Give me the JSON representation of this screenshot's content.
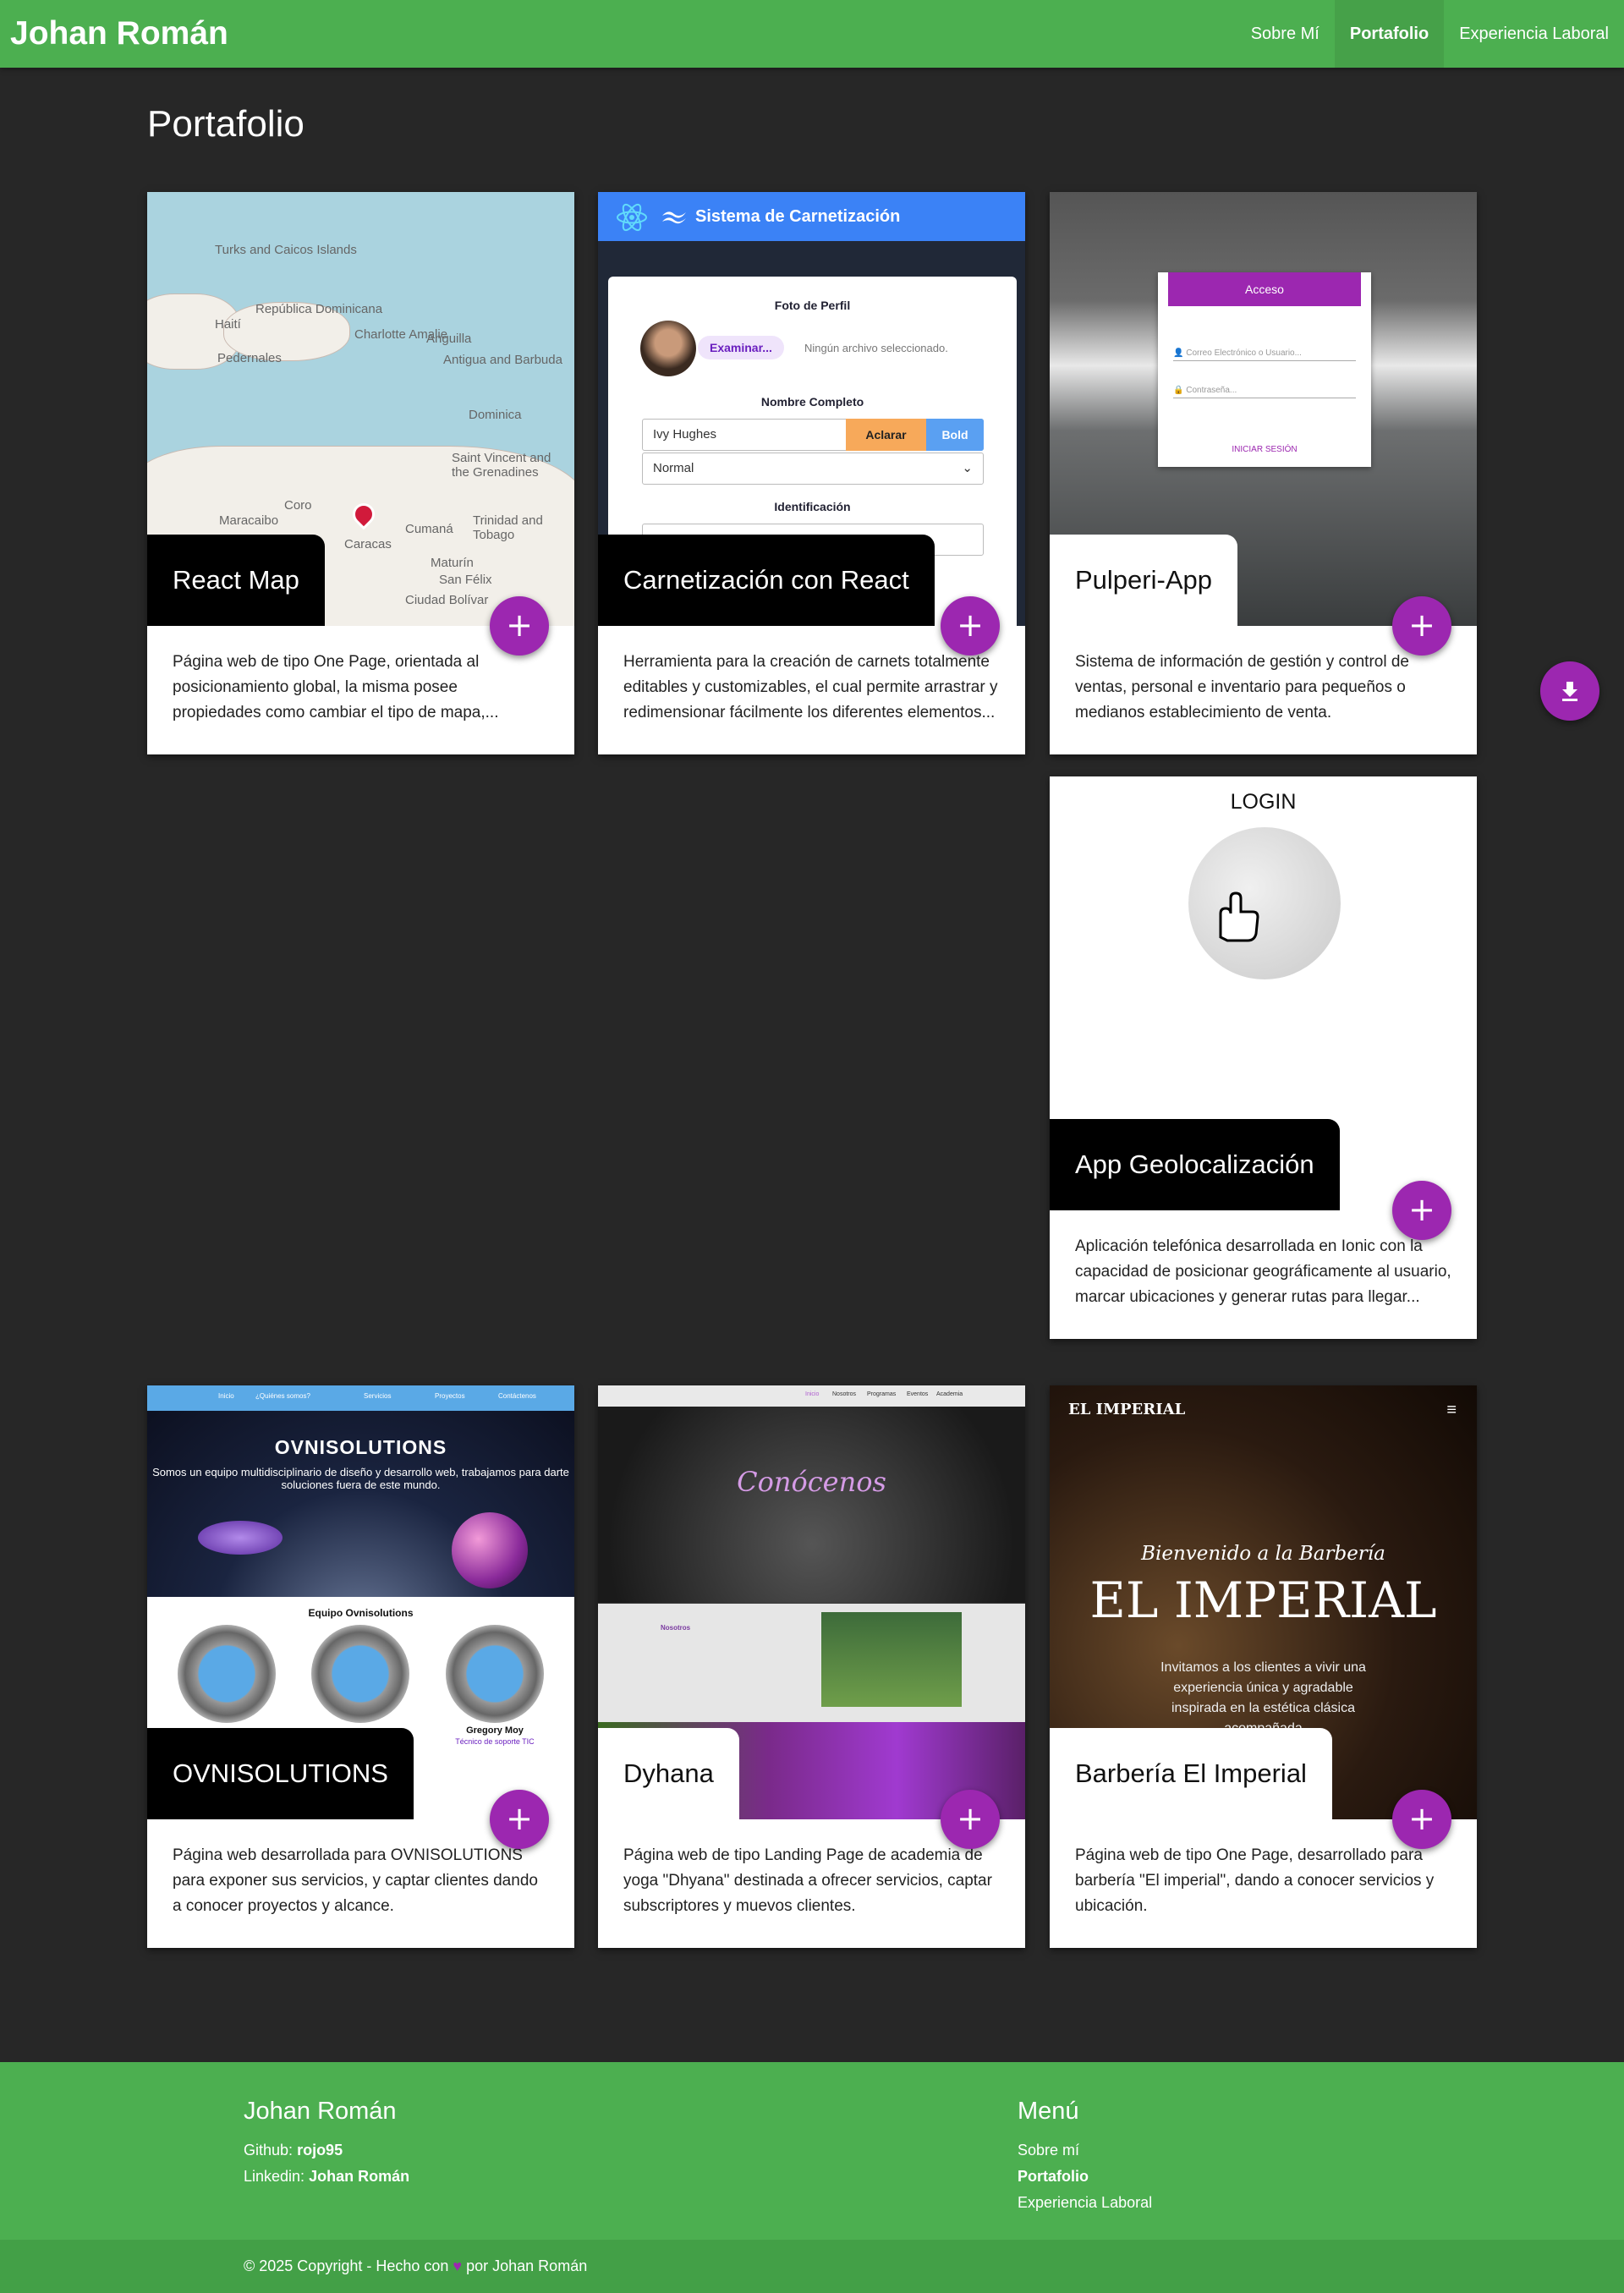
{
  "nav": {
    "brand": "Johan Román",
    "links": [
      {
        "label": "Sobre Mí",
        "active": false
      },
      {
        "label": "Portafolio",
        "active": true
      },
      {
        "label": "Experiencia Laboral",
        "active": false
      }
    ]
  },
  "page": {
    "title": "Portafolio"
  },
  "fab_icon": "+",
  "download_icon": "download-icon",
  "cards": [
    {
      "title": "React Map",
      "description": "Página web de tipo One Page, orientada al posicionamiento global, la misma posee propiedades como cambiar el tipo de mapa,...",
      "image_labels": [
        "Turks and Caicos Islands",
        "República Dominicana",
        "Haití",
        "Charlotte Amalie",
        "Anguilla",
        "Antigua and Barbuda",
        "Dominica",
        "Saint Vincent and the Grenadines",
        "Trinidad and Tobago",
        "Coro",
        "Maracaibo",
        "Caracas",
        "Cumaná",
        "Maturín",
        "San Félix",
        "Ciudad Bolívar",
        "Pedernales"
      ]
    },
    {
      "title": "Carnetización con React",
      "description": "Herramienta para la creación de carnets totalmente editables y customizables, el cual permite arrastrar y redimensionar fácilmente los diferentes elementos...",
      "image": {
        "app_title": "Sistema de Carnetización",
        "foto_label": "Foto de Perfil",
        "browse_button": "Examinar...",
        "no_file": "Ningún archivo seleccionado.",
        "name_label": "Nombre Completo",
        "name_value": "Ivy Hughes",
        "clear_button": "Aclarar",
        "bold_button": "Bold",
        "style_value": "Normal",
        "id_label": "Identificación"
      }
    },
    {
      "title": "Pulperi-App",
      "description": "Sistema de información de gestión y control de ventas, personal e inventario para pequeños o medianos establecimiento de venta.",
      "image": {
        "login_title": "Acceso",
        "email_placeholder": "Correo Electrónico o Usuario...",
        "password_placeholder": "Contraseña...",
        "submit": "INICIAR SESIÓN"
      }
    },
    {
      "title": "App Geolocalización",
      "description": "Aplicación telefónica desarrollada en Ionic con la capacidad de posicionar geográficamente al usuario, marcar ubicaciones y generar rutas para llegar...",
      "image": {
        "login_label": "LOGIN"
      }
    },
    {
      "title": "OVNISOLUTIONS",
      "description": "Página web desarrollada para OVNISOLUTIONS para exponer sus servicios, y captar clientes dando a conocer proyectos y alcance.",
      "image": {
        "nav_items": [
          "Inicio",
          "¿Quiénes somos?",
          "Servicios",
          "Proyectos",
          "Contáctenos"
        ],
        "hero_title": "OVNISOLUTIONS",
        "hero_sub": "Somos un equipo multidisciplinario de diseño y desarrollo web, trabajamos para darte soluciones fuera de este mundo.",
        "team_title": "Equipo Ovnisolutions",
        "member_name": "Gregory Moy",
        "member_role": "Técnico de soporte TIC"
      }
    },
    {
      "title": "Dyhana",
      "description": "Página web de tipo Landing Page de academia de yoga \"Dhyana\" destinada a ofrecer servicios, captar subscriptores y muevos clientes.",
      "image": {
        "nav_items": [
          "Inicio",
          "Nosotros",
          "Programas",
          "Eventos",
          "Academia"
        ],
        "hero_title": "Conócenos",
        "section_title": "Nosotros"
      }
    },
    {
      "title": "Barbería El Imperial",
      "description": "Página web de tipo One Page, desarrollado para barbería \"El imperial\", dando a conocer servicios y ubicación.",
      "image": {
        "logo": "EL IMPERIAL",
        "welcome": "Bienvenido a la Barbería",
        "name": "EL IMPERIAL",
        "text": "Invitamos a los clientes a vivir una experiencia única y agradable inspirada en la estética clásica acompañada"
      }
    }
  ],
  "footer": {
    "name": "Johan Román",
    "github_label": "Github:",
    "github_value": "rojo95",
    "linkedin_label": "Linkedin:",
    "linkedin_value": "Johan Román",
    "menu_title": "Menú",
    "menu": [
      {
        "label": "Sobre mí",
        "active": false
      },
      {
        "label": "Portafolio",
        "active": true
      },
      {
        "label": "Experiencia Laboral",
        "active": false
      }
    ],
    "copyright_prefix": "© 2025 Copyright - Hecho con",
    "copyright_suffix": "por Johan Román",
    "heart": "♥"
  },
  "colors": {
    "primary": "#4caf50",
    "accent": "#9c27b0",
    "background": "#272727"
  }
}
